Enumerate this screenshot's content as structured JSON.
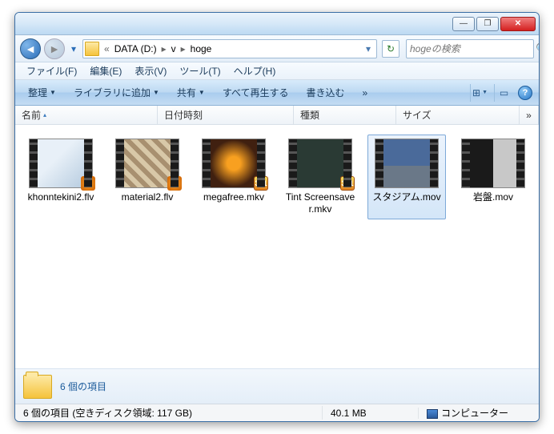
{
  "titlebar": {
    "min": "—",
    "max": "❐",
    "close": "✕"
  },
  "nav": {
    "back": "◄",
    "forward": "►",
    "dropdown": "▾",
    "refresh": "↻"
  },
  "path": {
    "root": "DATA (D:)",
    "p1": "v",
    "p2": "hoge",
    "sep": "▸",
    "leadsep": "«",
    "drop": "▾"
  },
  "search": {
    "placeholder": "hogeの検索",
    "icon": "🔍"
  },
  "menu": {
    "file": "ファイル(F)",
    "edit": "編集(E)",
    "view": "表示(V)",
    "tools": "ツール(T)",
    "help": "ヘルプ(H)"
  },
  "toolbar": {
    "organize": "整理",
    "library": "ライブラリに追加",
    "share": "共有",
    "playall": "すべて再生する",
    "burn": "書き込む",
    "more": "»",
    "views": "⊞",
    "preview": "▭",
    "help": "?"
  },
  "columns": {
    "name": "名前",
    "date": "日付時刻",
    "type": "種類",
    "size": "サイズ",
    "more": "»",
    "sort": "▴"
  },
  "files": [
    {
      "name": "khonntekini2.flv",
      "thumb": "t1",
      "overlay": "ov-wmp"
    },
    {
      "name": "material2.flv",
      "thumb": "t2",
      "overlay": "ov-wmp"
    },
    {
      "name": "megafree.mkv",
      "thumb": "t3",
      "overlay": "ov-mpc"
    },
    {
      "name": "Tint Screensaver.mkv",
      "thumb": "t4",
      "overlay": "ov-mpc"
    },
    {
      "name": "スタジアム.mov",
      "thumb": "t5",
      "overlay": "",
      "selected": true
    },
    {
      "name": "岩盤.mov",
      "thumb": "t6",
      "overlay": ""
    }
  ],
  "details": {
    "summary": "6 個の項目"
  },
  "status": {
    "items": "6 個の項目 (空きディスク領域: 117 GB)",
    "size": "40.1 MB",
    "computer": "コンピューター"
  }
}
